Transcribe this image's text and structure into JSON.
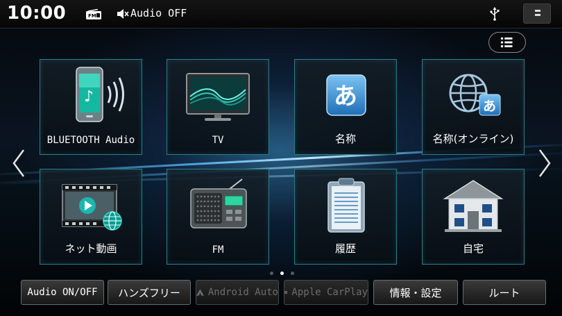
{
  "status_bar": {
    "clock": "10:00",
    "source_icon": "fm-radio-icon",
    "audio_status": "Audio OFF",
    "usb_icon": "usb-icon",
    "menu_icon": "menu-square-icon"
  },
  "list_button_icon": "list-icon",
  "tiles": [
    {
      "label": "BLUETOOTH Audio",
      "icon": "bluetooth-audio-phone-icon"
    },
    {
      "label": "TV",
      "icon": "tv-icon"
    },
    {
      "label": "名称",
      "icon": "hiragana-a-icon"
    },
    {
      "label": "名称(オンライン)",
      "icon": "globe-hiragana-icon"
    },
    {
      "label": "ネット動画",
      "icon": "net-video-icon"
    },
    {
      "label": "FM",
      "icon": "radio-icon"
    },
    {
      "label": "履歴",
      "icon": "history-clipboard-icon"
    },
    {
      "label": "自宅",
      "icon": "home-icon"
    }
  ],
  "pagination": {
    "pages": 3,
    "current": 2
  },
  "bottom_buttons": [
    {
      "label": "Audio ON/OFF",
      "enabled": true
    },
    {
      "label": "ハンズフリー",
      "enabled": true
    },
    {
      "label": "Android Auto",
      "enabled": false,
      "icon": "android-auto-icon"
    },
    {
      "label": "Apple CarPlay",
      "enabled": false,
      "icon": "apple-carplay-icon"
    },
    {
      "label": "情報・設定",
      "enabled": true
    },
    {
      "label": "ルート",
      "enabled": true
    }
  ],
  "colors": {
    "tile_border": "#2b7d8a",
    "accent": "#3fa0e0"
  }
}
